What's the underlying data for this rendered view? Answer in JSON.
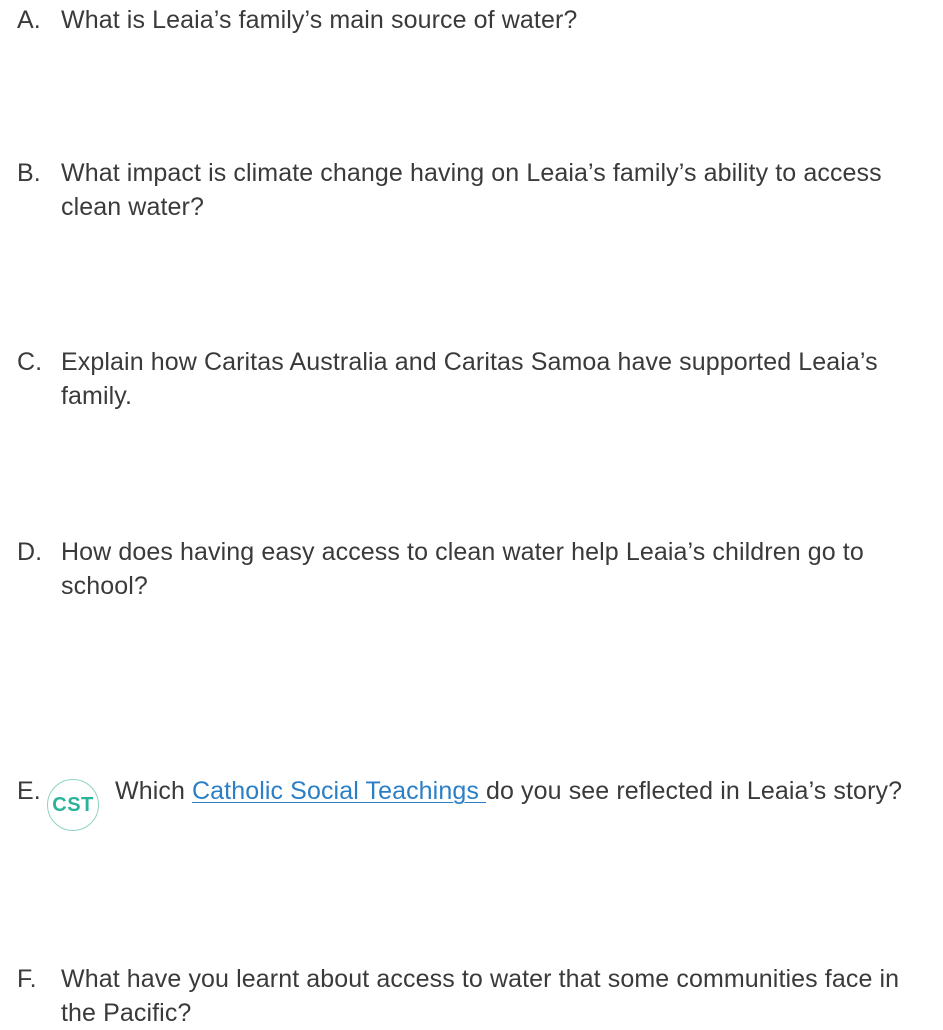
{
  "questions": [
    {
      "letter": "A.",
      "text": "What is Leaia’s family’s main source of water?"
    },
    {
      "letter": "B.",
      "text": "What impact is climate change having on Leaia’s family’s ability to access clean water?"
    },
    {
      "letter": "C.",
      "text": "Explain how Caritas Australia and Caritas Samoa have supported Leaia’s family."
    },
    {
      "letter": "D.",
      "text": "How does having easy access to clean water help Leaia’s children go to school?"
    },
    {
      "letter": "E.",
      "badge": "CST",
      "before_link": "Which ",
      "link_text": "Catholic Social Teachings ",
      "after_link": "do you see reflected in Leaia’s story?"
    },
    {
      "letter": "F.",
      "text": "What have you learnt about access to water that some communities face in the Pacific?"
    }
  ],
  "colors": {
    "text": "#3a3a3a",
    "link": "#2b7fc6",
    "badge_text": "#2bb39a",
    "badge_border": "#8fd3c4"
  }
}
